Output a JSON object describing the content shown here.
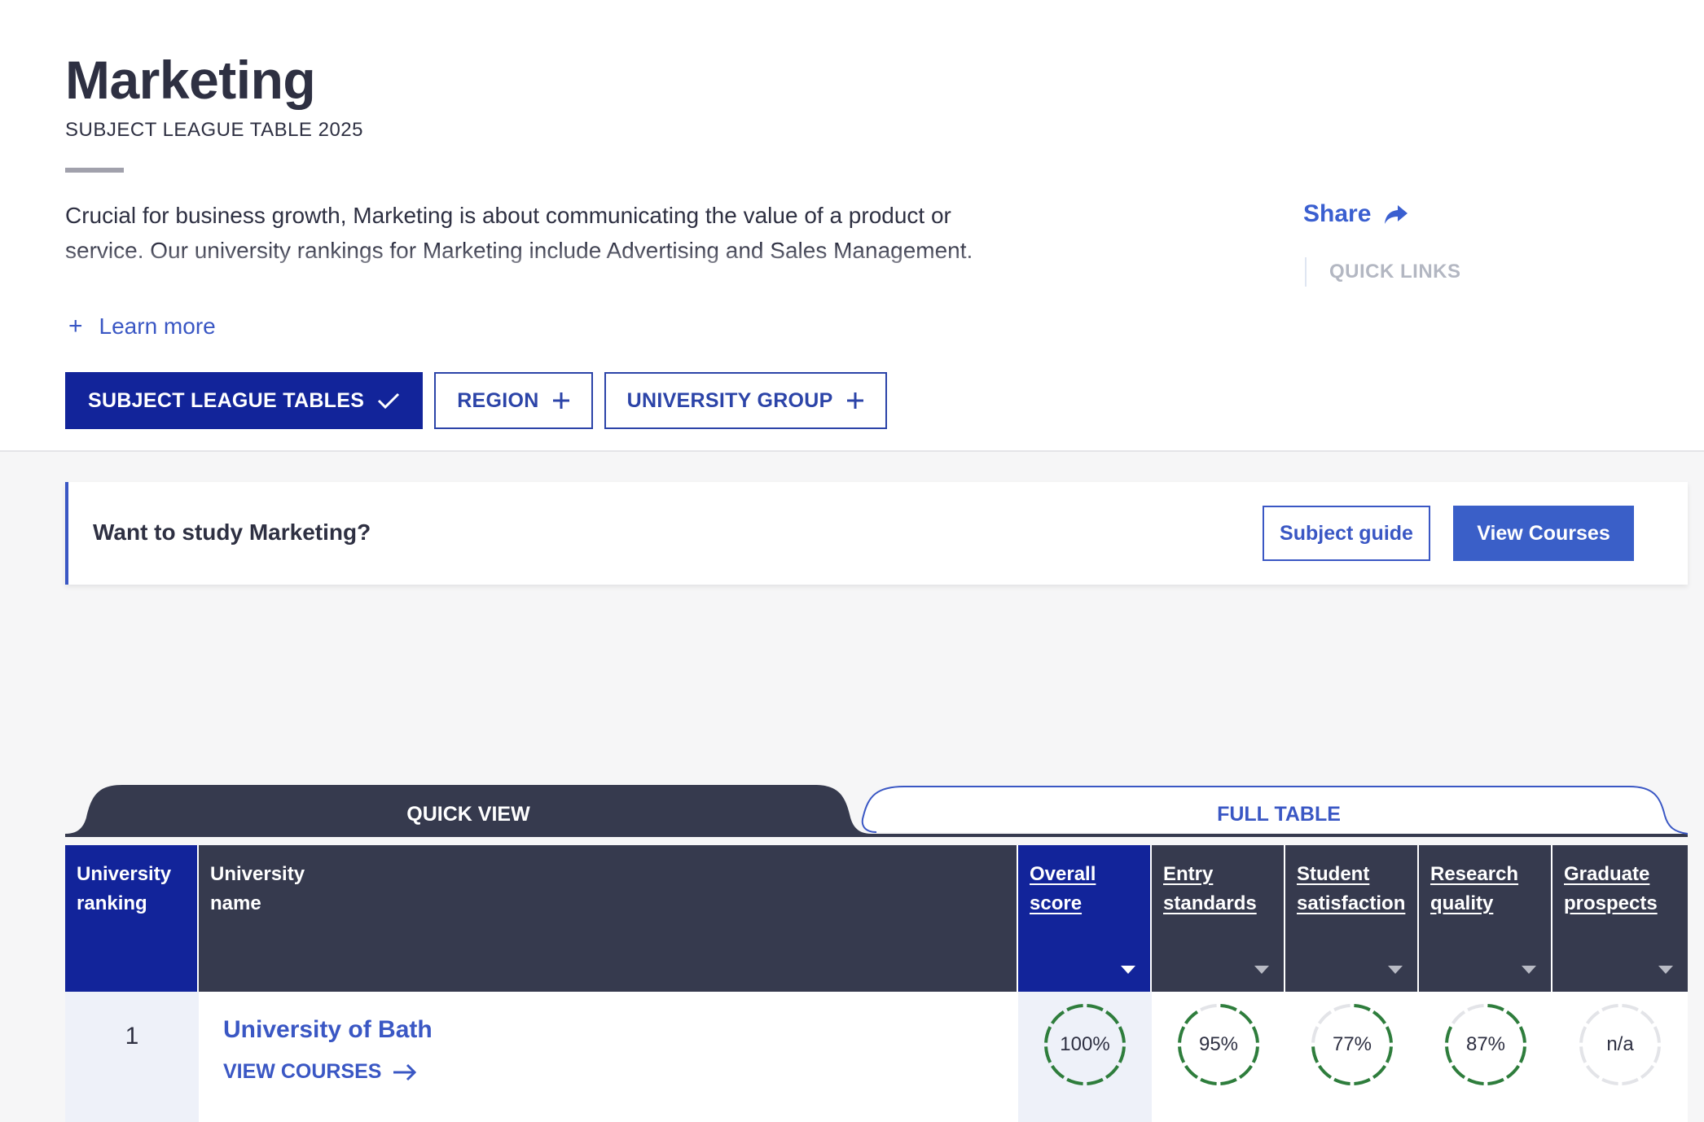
{
  "header": {
    "title": "Marketing",
    "subtitle": "SUBJECT LEAGUE TABLE 2025",
    "description": "Crucial for business growth, Marketing is about communicating the value of a product or service. Our university rankings for Marketing include Advertising and Sales Management.",
    "learn_more": "Learn more",
    "share": "Share",
    "quick_links": "QUICK LINKS"
  },
  "filters": {
    "subject": "SUBJECT LEAGUE TABLES",
    "region": "REGION",
    "group": "UNIVERSITY GROUP"
  },
  "study": {
    "question": "Want to study Marketing?",
    "guide": "Subject guide",
    "courses": "View Courses"
  },
  "tabs": {
    "quick": "QUICK VIEW",
    "full": "FULL TABLE"
  },
  "table": {
    "columns": [
      {
        "l1": "University",
        "l2": "ranking"
      },
      {
        "l1": "University",
        "l2": "name"
      },
      {
        "l1": "Overall",
        "l2": "score"
      },
      {
        "l1": "Entry",
        "l2": "standards"
      },
      {
        "l1": "Student",
        "l2": "satisfaction"
      },
      {
        "l1": "Research",
        "l2": "quality"
      },
      {
        "l1": "Graduate",
        "l2": "prospects"
      }
    ],
    "rows": [
      {
        "rank": "1",
        "name": "University of Bath",
        "view_courses": "VIEW COURSES",
        "scores": [
          {
            "label": "100%",
            "value": 100
          },
          {
            "label": "95%",
            "value": 95
          },
          {
            "label": "77%",
            "value": 77
          },
          {
            "label": "87%",
            "value": 87
          },
          {
            "label": "n/a",
            "value": 0
          }
        ]
      }
    ]
  },
  "colors": {
    "navy": "#12249a",
    "accent": "#3a57c4",
    "header_dark": "#363a4e",
    "ring_green": "#2e7d3c",
    "ring_grey": "#e3e4e8"
  }
}
